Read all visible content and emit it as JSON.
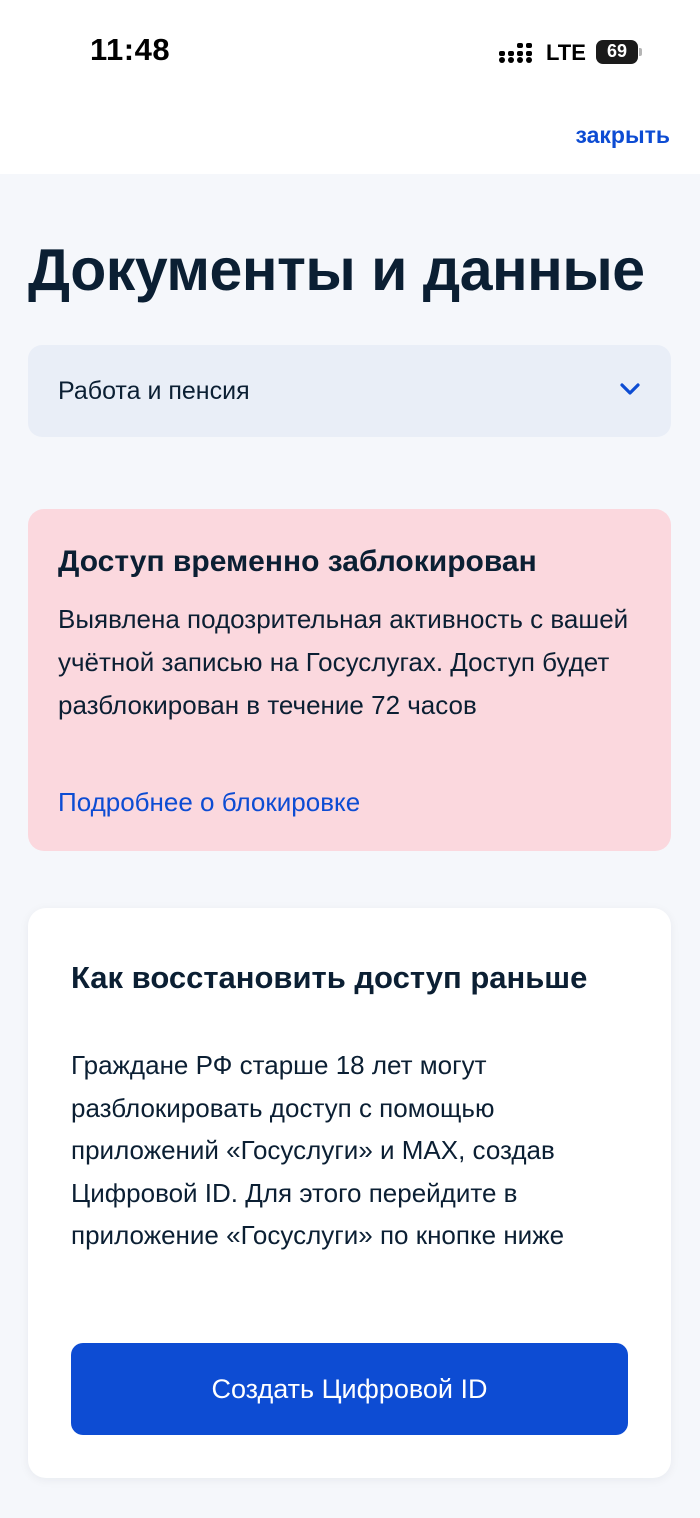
{
  "status_bar": {
    "time": "11:48",
    "network": "LTE",
    "battery_level": "69"
  },
  "nav": {
    "close_label": "закрыть"
  },
  "page": {
    "title": "Документы и данные"
  },
  "category_select": {
    "selected": "Работа и пенсия"
  },
  "alert": {
    "title": "Доступ временно заблокирован",
    "text": "Выявлена подозрительная активность с вашей учётной записью на Госуслугах. Доступ будет разблокирован в течение 72 часов",
    "link_label": "Подробнее о блокировке"
  },
  "info_card": {
    "title": "Как восстановить доступ раньше",
    "text": "Граждане РФ старше 18 лет могут разблокировать доступ с помощью приложений «Госуслуги» и MAX, создав Цифровой ID. Для этого перейдите в приложение «Госуслуги» по кнопке ниже",
    "button_label": "Создать Цифровой ID"
  },
  "colors": {
    "accent": "#0d4cd3",
    "alert_background": "#fbd8de",
    "page_background": "#f5f7fb",
    "text": "#0b1f33"
  },
  "icons": [
    "signal-icon",
    "battery-icon",
    "chevron-down-icon"
  ]
}
